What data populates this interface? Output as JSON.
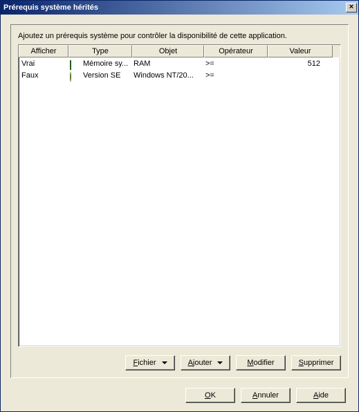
{
  "title": "Prérequis système hérités",
  "close_glyph": "×",
  "instruction": "Ajoutez un prérequis système pour contrôler la disponibilité de cette application.",
  "columns": {
    "c0": "Afficher",
    "c1": "Type",
    "c2": "Objet",
    "c3": "Opérateur",
    "c4": "Valeur"
  },
  "rows": [
    {
      "afficher": "Vrai",
      "icon": "chip",
      "type": "Mémoire sy...",
      "objet": "RAM",
      "operateur": ">=",
      "valeur": "512"
    },
    {
      "afficher": "Faux",
      "icon": "globe",
      "type": "Version SE",
      "objet": "Windows NT/20...",
      "operateur": ">=",
      "valeur": ""
    }
  ],
  "buttons": {
    "fichier": "Fichier",
    "ajouter": "Ajouter",
    "modifier": "Modifier",
    "supprimer": "Supprimer",
    "ok": "OK",
    "annuler": "Annuler",
    "aide": "Aide"
  },
  "underline": {
    "fichier": "F",
    "ajouter": "A",
    "modifier": "M",
    "supprimer": "S",
    "ok": "O",
    "annuler": "A",
    "aide": "A"
  }
}
